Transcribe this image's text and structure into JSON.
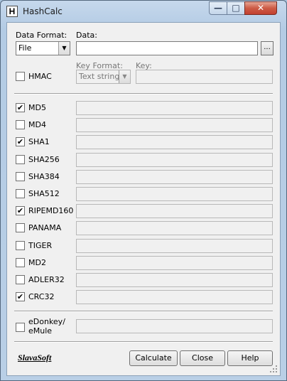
{
  "window": {
    "title": "HashCalc",
    "app_icon": "H",
    "min_glyph": "—",
    "max_glyph": "□",
    "close_glyph": "✕"
  },
  "input": {
    "data_format_label": "Data Format:",
    "data_format_value": "File",
    "data_label": "Data:",
    "data_value": "",
    "browse_label": "...",
    "hmac_label": "HMAC",
    "hmac_checked": false,
    "key_format_label": "Key Format:",
    "key_format_value": "Text string",
    "key_label": "Key:",
    "key_value": ""
  },
  "hashes": [
    {
      "label": "MD5",
      "checked": true,
      "value": ""
    },
    {
      "label": "MD4",
      "checked": false,
      "value": ""
    },
    {
      "label": "SHA1",
      "checked": true,
      "value": ""
    },
    {
      "label": "SHA256",
      "checked": false,
      "value": ""
    },
    {
      "label": "SHA384",
      "checked": false,
      "value": ""
    },
    {
      "label": "SHA512",
      "checked": false,
      "value": ""
    },
    {
      "label": "RIPEMD160",
      "checked": true,
      "value": ""
    },
    {
      "label": "PANAMA",
      "checked": false,
      "value": ""
    },
    {
      "label": "TIGER",
      "checked": false,
      "value": ""
    },
    {
      "label": "MD2",
      "checked": false,
      "value": ""
    },
    {
      "label": "ADLER32",
      "checked": false,
      "value": ""
    },
    {
      "label": "CRC32",
      "checked": true,
      "value": ""
    }
  ],
  "edonkey": {
    "label_line1": "eDonkey/",
    "label_line2": "eMule",
    "checked": false,
    "value": ""
  },
  "footer": {
    "logo": "SlavaSoft",
    "calculate": "Calculate",
    "close": "Close",
    "help": "Help"
  },
  "check_mark": "✔"
}
